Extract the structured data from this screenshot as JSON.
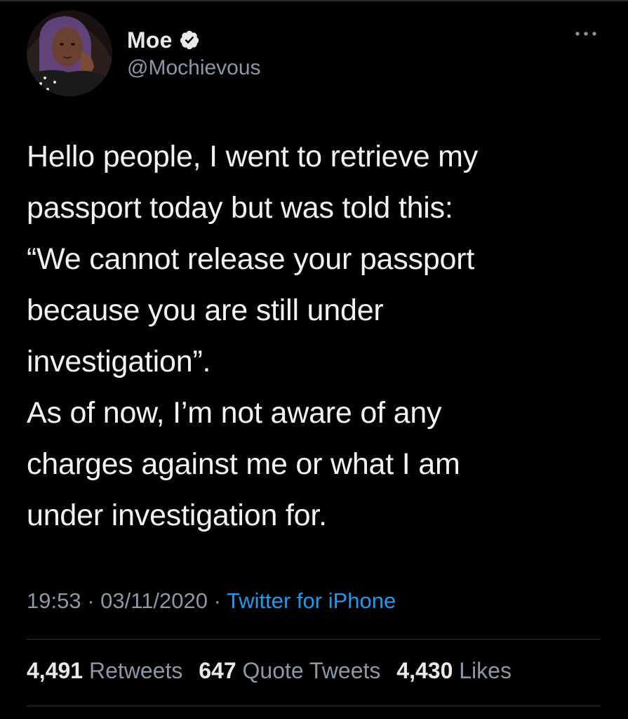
{
  "tweet": {
    "author": {
      "display_name": "Moe",
      "handle": "@Mochievous",
      "verified": true
    },
    "text": "Hello people, I went to retrieve my\npassport today but was told this:\n“We cannot release your passport\nbecause you are still under\ninvestigation”.\nAs of now, I’m not aware of any\ncharges against me or what I am\nunder investigation for.",
    "time": "19:53",
    "date": "03/11/2020",
    "separator": "·",
    "source": "Twitter for iPhone",
    "stats": {
      "retweets_count": "4,491",
      "retweets_label": "Retweets",
      "quotes_count": "647",
      "quotes_label": "Quote Tweets",
      "likes_count": "4,430",
      "likes_label": "Likes"
    }
  },
  "icons": {
    "more": "more-horizontal-icon",
    "verified": "verified-badge-icon"
  },
  "colors": {
    "background": "#000000",
    "text_primary": "#e7e9ea",
    "text_secondary": "#8b98a5",
    "link": "#1d9bf0",
    "divider": "#2f3336"
  }
}
